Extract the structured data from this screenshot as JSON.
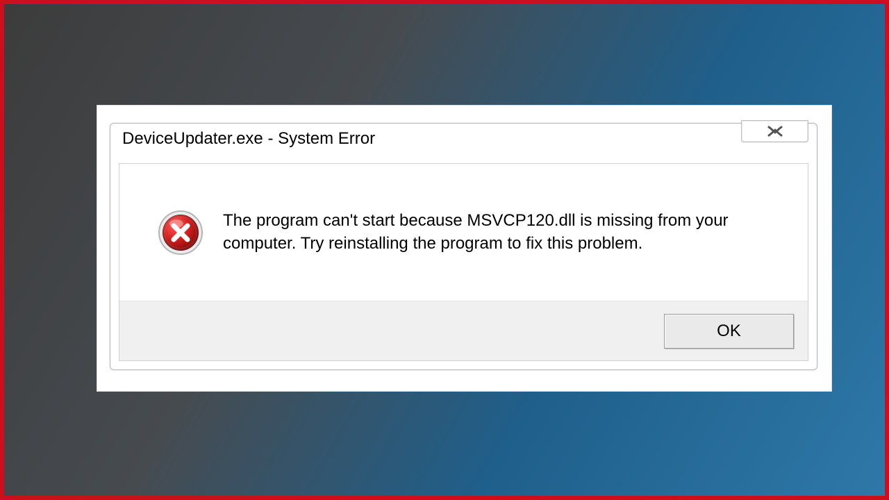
{
  "dialog": {
    "title": "DeviceUpdater.exe - System Error",
    "message": "The program can't start because MSVCP120.dll is missing from your computer. Try reinstalling the program to fix this problem.",
    "ok_label": "OK"
  },
  "colors": {
    "frame_border": "#cc0f1f",
    "error_red": "#cc2a2a"
  }
}
